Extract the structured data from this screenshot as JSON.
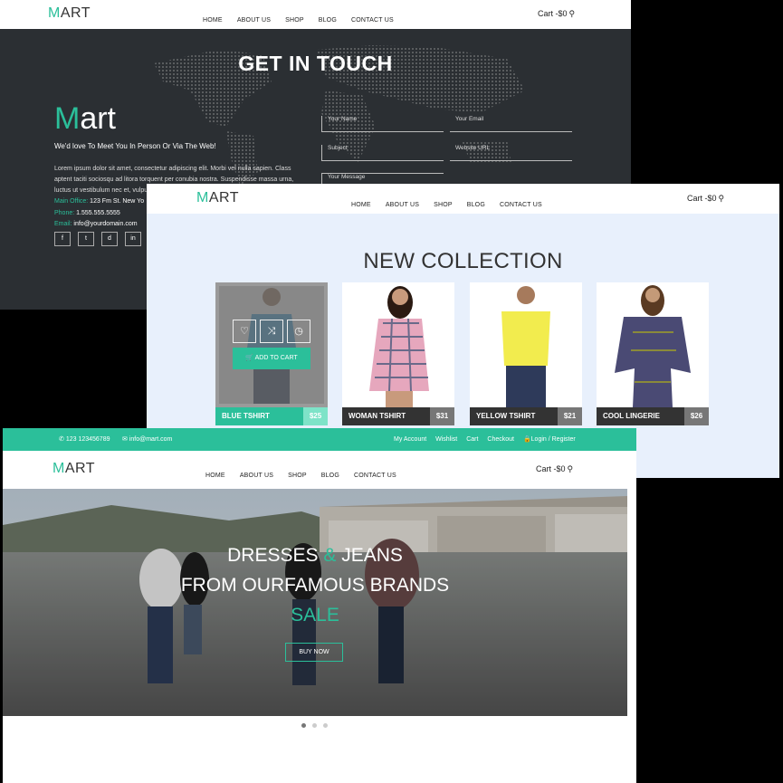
{
  "nav": {
    "logo_m": "M",
    "logo_rest": "ART",
    "items": [
      "HOME",
      "ABOUT US",
      "SHOP",
      "BLOG",
      "CONTACT US"
    ],
    "cart": "Cart -$0"
  },
  "contact": {
    "title": "GET IN TOUCH",
    "brand_m": "M",
    "brand_rest": "art",
    "tagline": "We'd love To Meet You In Person Or Via The Web!",
    "lorem": "Lorem ipsum dolor sit amet, consectetur adipiscing elit. Morbi vel nulla sapien. Class aptent taciti sociosqu ad litora torquent per conubia nostra. Suspendisse massa urna, luctus ut vestibulum nec et, vulputate",
    "office_label": "Main Office:",
    "office_value": "123 Fm St. New Yo",
    "phone_label": "Phone:",
    "phone_value": "1.555.555.5555",
    "email_label": "Email:",
    "email_value": "info@yourdomain.com",
    "fields": {
      "name": "Your Name",
      "email": "Your Email",
      "subject": "Subject",
      "website": "Website URL",
      "message": "Your Message"
    },
    "social": [
      "f",
      "t",
      "d",
      "in"
    ]
  },
  "collection": {
    "title": "NEW COLLECTION",
    "add_to_cart": "ADD TO CART",
    "products": [
      {
        "name": "BLUE TSHIRT",
        "price": "$25"
      },
      {
        "name": "WOMAN TSHIRT",
        "price": "$31"
      },
      {
        "name": "YELLOW TSHIRT",
        "price": "$21"
      },
      {
        "name": "COOL LINGERIE",
        "price": "$26"
      }
    ]
  },
  "home": {
    "phone": "123 123456789",
    "email": "info@mart.com",
    "links": [
      "My Account",
      "Wishlist",
      "Cart",
      "Checkout"
    ],
    "login": "Login / Register",
    "hero_line1_a": "DRESSES",
    "hero_line1_amp": "&",
    "hero_line1_b": "JEANS",
    "hero_line2": "FROM OURFAMOUS BRANDS",
    "hero_line3": "SALE",
    "buy_now": "BUY NOW"
  },
  "colors": {
    "accent": "#2bbf9a",
    "dark": "#2b2f33",
    "collection_bg": "#e8f0fc"
  }
}
